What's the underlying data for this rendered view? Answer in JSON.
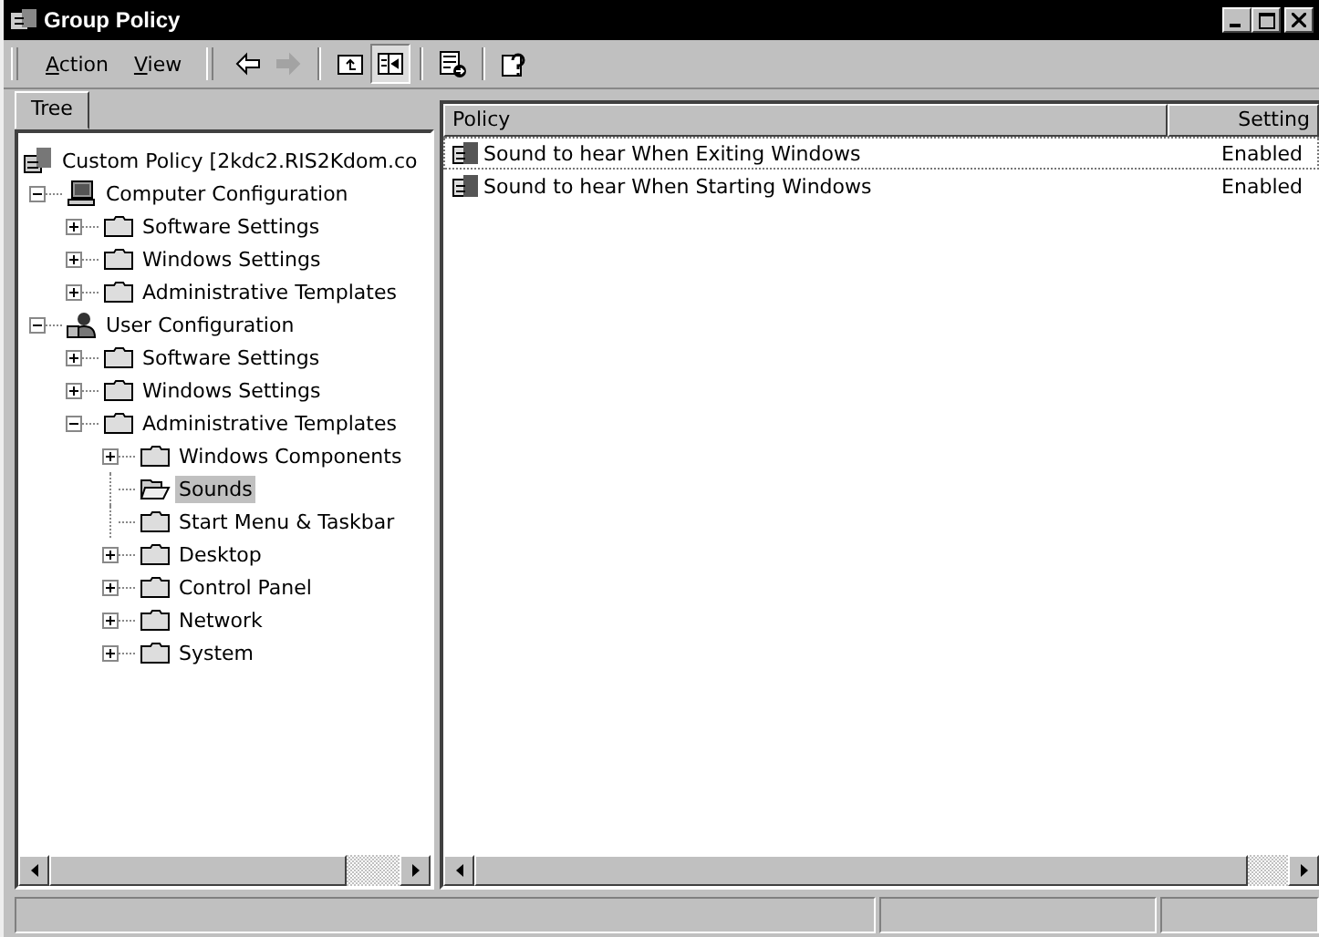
{
  "window": {
    "title": "Group Policy"
  },
  "menu": [
    "Action",
    "View"
  ],
  "toolbar": [
    {
      "kind": "back",
      "disabled": false,
      "pressed": false
    },
    {
      "kind": "forward",
      "disabled": true,
      "pressed": false
    },
    {
      "kind": "up",
      "disabled": false,
      "pressed": false
    },
    {
      "kind": "tree",
      "disabled": false,
      "pressed": true
    },
    {
      "kind": "export",
      "disabled": false,
      "pressed": false
    },
    {
      "kind": "help",
      "disabled": false,
      "pressed": false
    }
  ],
  "tree_tab": {
    "label": "Tree"
  },
  "tree": [
    {
      "label": "Custom Policy [2kdc2.RIS2Kdom.co",
      "kind": "root",
      "selected": false,
      "children": [
        {
          "label": "Computer Configuration",
          "kind": "computer",
          "has_children": true,
          "expanded": true,
          "selected": false,
          "children": [
            {
              "label": "Software Settings",
              "kind": "folder",
              "has_children": true,
              "expanded": false,
              "selected": false
            },
            {
              "label": "Windows Settings",
              "kind": "folder",
              "has_children": true,
              "expanded": false,
              "selected": false
            },
            {
              "label": "Administrative Templates",
              "kind": "folder",
              "has_children": true,
              "expanded": false,
              "selected": false
            }
          ]
        },
        {
          "label": "User Configuration",
          "kind": "user",
          "has_children": true,
          "expanded": true,
          "selected": false,
          "children": [
            {
              "label": "Software Settings",
              "kind": "folder",
              "has_children": true,
              "expanded": false,
              "selected": false
            },
            {
              "label": "Windows Settings",
              "kind": "folder",
              "has_children": true,
              "expanded": false,
              "selected": false
            },
            {
              "label": "Administrative Templates",
              "kind": "folder",
              "has_children": true,
              "expanded": true,
              "selected": false,
              "children": [
                {
                  "label": "Windows Components",
                  "kind": "folder",
                  "has_children": true,
                  "expanded": false,
                  "selected": false
                },
                {
                  "label": "Sounds",
                  "kind": "folder",
                  "has_children": false,
                  "selected": true
                },
                {
                  "label": "Start Menu & Taskbar",
                  "kind": "folder",
                  "has_children": false,
                  "selected": false
                },
                {
                  "label": "Desktop",
                  "kind": "folder",
                  "has_children": true,
                  "expanded": false,
                  "selected": false
                },
                {
                  "label": "Control Panel",
                  "kind": "folder",
                  "has_children": true,
                  "expanded": false,
                  "selected": false
                },
                {
                  "label": "Network",
                  "kind": "folder",
                  "has_children": true,
                  "expanded": false,
                  "selected": false
                },
                {
                  "label": "System",
                  "kind": "folder",
                  "has_children": true,
                  "expanded": false,
                  "selected": false
                }
              ]
            }
          ]
        }
      ]
    }
  ],
  "table": {
    "columns": [
      "Policy",
      "Setting"
    ],
    "rows": [
      {
        "policy": "Sound to hear When Exiting Windows",
        "setting": "Enabled",
        "focused": true
      },
      {
        "policy": "Sound to hear When Starting Windows",
        "setting": "Enabled",
        "focused": false
      }
    ]
  }
}
